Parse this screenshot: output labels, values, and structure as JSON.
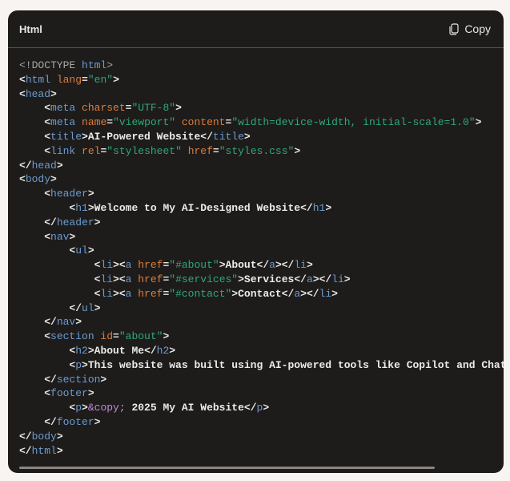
{
  "header": {
    "language": "Html",
    "copy_label": "Copy",
    "copy_icon": "copy-icon"
  },
  "colors": {
    "tag": "#6d9bd1",
    "attribute": "#e07b3a",
    "string": "#2fa877",
    "text": "#ecebe9",
    "doctype": "#a9a7a4",
    "entity": "#c68ad6",
    "background": "#1d1c1b"
  },
  "code_lines": [
    [
      [
        "d",
        "<!DOCTYPE "
      ],
      [
        "t",
        "html"
      ],
      [
        "d",
        ">"
      ]
    ],
    [
      [
        "p",
        "<"
      ],
      [
        "t",
        "html"
      ],
      [
        "a",
        " lang"
      ],
      [
        "p",
        "="
      ],
      [
        "s",
        "\"en\""
      ],
      [
        "p",
        ">"
      ]
    ],
    [
      [
        "p",
        "<"
      ],
      [
        "t",
        "head"
      ],
      [
        "p",
        ">"
      ]
    ],
    [
      [
        "p",
        "    <"
      ],
      [
        "t",
        "meta"
      ],
      [
        "a",
        " charset"
      ],
      [
        "p",
        "="
      ],
      [
        "s",
        "\"UTF-8\""
      ],
      [
        "p",
        ">"
      ]
    ],
    [
      [
        "p",
        "    <"
      ],
      [
        "t",
        "meta"
      ],
      [
        "a",
        " name"
      ],
      [
        "p",
        "="
      ],
      [
        "s",
        "\"viewport\""
      ],
      [
        "a",
        " content"
      ],
      [
        "p",
        "="
      ],
      [
        "s",
        "\"width=device-width, initial-scale=1.0\""
      ],
      [
        "p",
        ">"
      ]
    ],
    [
      [
        "p",
        "    <"
      ],
      [
        "t",
        "title"
      ],
      [
        "p",
        ">"
      ],
      [
        "x",
        "AI-Powered Website"
      ],
      [
        "p",
        "</"
      ],
      [
        "t",
        "title"
      ],
      [
        "p",
        ">"
      ]
    ],
    [
      [
        "p",
        "    <"
      ],
      [
        "t",
        "link"
      ],
      [
        "a",
        " rel"
      ],
      [
        "p",
        "="
      ],
      [
        "s",
        "\"stylesheet\""
      ],
      [
        "a",
        " href"
      ],
      [
        "p",
        "="
      ],
      [
        "s",
        "\"styles.css\""
      ],
      [
        "p",
        ">"
      ]
    ],
    [
      [
        "p",
        "</"
      ],
      [
        "t",
        "head"
      ],
      [
        "p",
        ">"
      ]
    ],
    [
      [
        "p",
        "<"
      ],
      [
        "t",
        "body"
      ],
      [
        "p",
        ">"
      ]
    ],
    [
      [
        "p",
        "    <"
      ],
      [
        "t",
        "header"
      ],
      [
        "p",
        ">"
      ]
    ],
    [
      [
        "p",
        "        <"
      ],
      [
        "t",
        "h1"
      ],
      [
        "p",
        ">"
      ],
      [
        "x",
        "Welcome to My AI-Designed Website"
      ],
      [
        "p",
        "</"
      ],
      [
        "t",
        "h1"
      ],
      [
        "p",
        ">"
      ]
    ],
    [
      [
        "p",
        "    </"
      ],
      [
        "t",
        "header"
      ],
      [
        "p",
        ">"
      ]
    ],
    [
      [
        "p",
        "    <"
      ],
      [
        "t",
        "nav"
      ],
      [
        "p",
        ">"
      ]
    ],
    [
      [
        "p",
        "        <"
      ],
      [
        "t",
        "ul"
      ],
      [
        "p",
        ">"
      ]
    ],
    [
      [
        "p",
        "            <"
      ],
      [
        "t",
        "li"
      ],
      [
        "p",
        "><"
      ],
      [
        "t",
        "a"
      ],
      [
        "a",
        " href"
      ],
      [
        "p",
        "="
      ],
      [
        "s",
        "\"#about\""
      ],
      [
        "p",
        ">"
      ],
      [
        "x",
        "About"
      ],
      [
        "p",
        "</"
      ],
      [
        "t",
        "a"
      ],
      [
        "p",
        "></"
      ],
      [
        "t",
        "li"
      ],
      [
        "p",
        ">"
      ]
    ],
    [
      [
        "p",
        "            <"
      ],
      [
        "t",
        "li"
      ],
      [
        "p",
        "><"
      ],
      [
        "t",
        "a"
      ],
      [
        "a",
        " href"
      ],
      [
        "p",
        "="
      ],
      [
        "s",
        "\"#services\""
      ],
      [
        "p",
        ">"
      ],
      [
        "x",
        "Services"
      ],
      [
        "p",
        "</"
      ],
      [
        "t",
        "a"
      ],
      [
        "p",
        "></"
      ],
      [
        "t",
        "li"
      ],
      [
        "p",
        ">"
      ]
    ],
    [
      [
        "p",
        "            <"
      ],
      [
        "t",
        "li"
      ],
      [
        "p",
        "><"
      ],
      [
        "t",
        "a"
      ],
      [
        "a",
        " href"
      ],
      [
        "p",
        "="
      ],
      [
        "s",
        "\"#contact\""
      ],
      [
        "p",
        ">"
      ],
      [
        "x",
        "Contact"
      ],
      [
        "p",
        "</"
      ],
      [
        "t",
        "a"
      ],
      [
        "p",
        "></"
      ],
      [
        "t",
        "li"
      ],
      [
        "p",
        ">"
      ]
    ],
    [
      [
        "p",
        "        </"
      ],
      [
        "t",
        "ul"
      ],
      [
        "p",
        ">"
      ]
    ],
    [
      [
        "p",
        "    </"
      ],
      [
        "t",
        "nav"
      ],
      [
        "p",
        ">"
      ]
    ],
    [
      [
        "p",
        "    <"
      ],
      [
        "t",
        "section"
      ],
      [
        "a",
        " id"
      ],
      [
        "p",
        "="
      ],
      [
        "s",
        "\"about\""
      ],
      [
        "p",
        ">"
      ]
    ],
    [
      [
        "p",
        "        <"
      ],
      [
        "t",
        "h2"
      ],
      [
        "p",
        ">"
      ],
      [
        "x",
        "About Me"
      ],
      [
        "p",
        "</"
      ],
      [
        "t",
        "h2"
      ],
      [
        "p",
        ">"
      ]
    ],
    [
      [
        "p",
        "        <"
      ],
      [
        "t",
        "p"
      ],
      [
        "p",
        ">"
      ],
      [
        "x",
        "This website was built using AI-powered tools like Copilot and ChatGPT."
      ],
      [
        "p",
        "</"
      ],
      [
        "t",
        "p"
      ],
      [
        "p",
        ">"
      ]
    ],
    [
      [
        "p",
        "    </"
      ],
      [
        "t",
        "section"
      ],
      [
        "p",
        ">"
      ]
    ],
    [
      [
        "p",
        "    <"
      ],
      [
        "t",
        "footer"
      ],
      [
        "p",
        ">"
      ]
    ],
    [
      [
        "p",
        "        <"
      ],
      [
        "t",
        "p"
      ],
      [
        "p",
        ">"
      ],
      [
        "e",
        "&copy;"
      ],
      [
        "x",
        " 2025 My AI Website"
      ],
      [
        "p",
        "</"
      ],
      [
        "t",
        "p"
      ],
      [
        "p",
        ">"
      ]
    ],
    [
      [
        "p",
        "    </"
      ],
      [
        "t",
        "footer"
      ],
      [
        "p",
        ">"
      ]
    ],
    [
      [
        "p",
        "</"
      ],
      [
        "t",
        "body"
      ],
      [
        "p",
        ">"
      ]
    ],
    [
      [
        "p",
        "</"
      ],
      [
        "t",
        "html"
      ],
      [
        "p",
        ">"
      ]
    ]
  ]
}
